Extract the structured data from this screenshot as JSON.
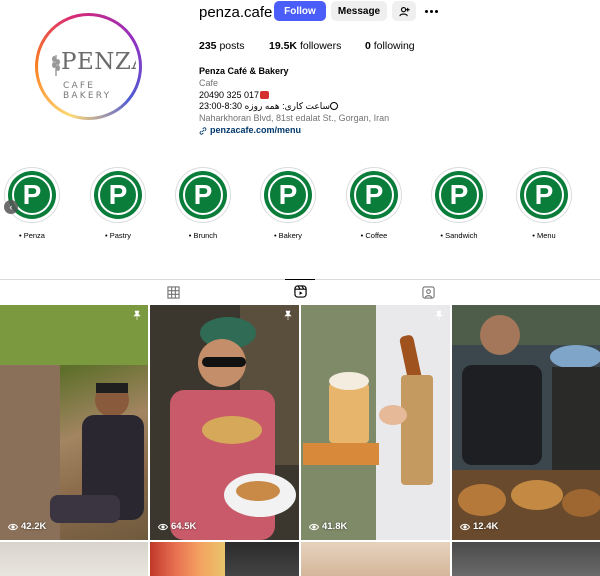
{
  "profile": {
    "username": "penza.cafe",
    "follow_label": "Follow",
    "message_label": "Message",
    "stats": {
      "posts_count": "235",
      "posts_label": "posts",
      "followers_count": "19.5K",
      "followers_label": "followers",
      "following_count": "0",
      "following_label": "following"
    },
    "logo": {
      "word": "PENZA",
      "sub": "CAFE BAKERY"
    },
    "bio": {
      "name": "Penza Café & Bakery",
      "category": "Cafe",
      "phone": "20490 325 017",
      "hours": "ساعت کاری: همه روزه 8:30-23:00",
      "address": "Naharkhoran Blvd, 81st edalat St., Gorgan, Iran",
      "link": "penzacafe.com/menu"
    }
  },
  "highlights": [
    {
      "label": "• Penza",
      "letter": "P"
    },
    {
      "label": "• Pastry",
      "letter": "P"
    },
    {
      "label": "• Brunch",
      "letter": "P"
    },
    {
      "label": "• Bakery",
      "letter": "P"
    },
    {
      "label": "• Coffee",
      "letter": "P"
    },
    {
      "label": "• Sandwich",
      "letter": "P"
    },
    {
      "label": "• Menu",
      "letter": "P"
    }
  ],
  "tabs": [
    {
      "name": "posts",
      "icon": "grid-icon",
      "active": false
    },
    {
      "name": "reels",
      "icon": "reels-icon",
      "active": true
    },
    {
      "name": "tagged",
      "icon": "tagged-icon",
      "active": false
    }
  ],
  "reels": [
    {
      "views": "42.2K",
      "pinned": true
    },
    {
      "views": "64.5K",
      "pinned": true
    },
    {
      "views": "41.8K",
      "pinned": true
    },
    {
      "views": "12.4K",
      "pinned": false
    }
  ],
  "colors": {
    "follow_button": "#4a5df9",
    "highlight_green": "#0b7d3a",
    "link": "#00376b"
  }
}
